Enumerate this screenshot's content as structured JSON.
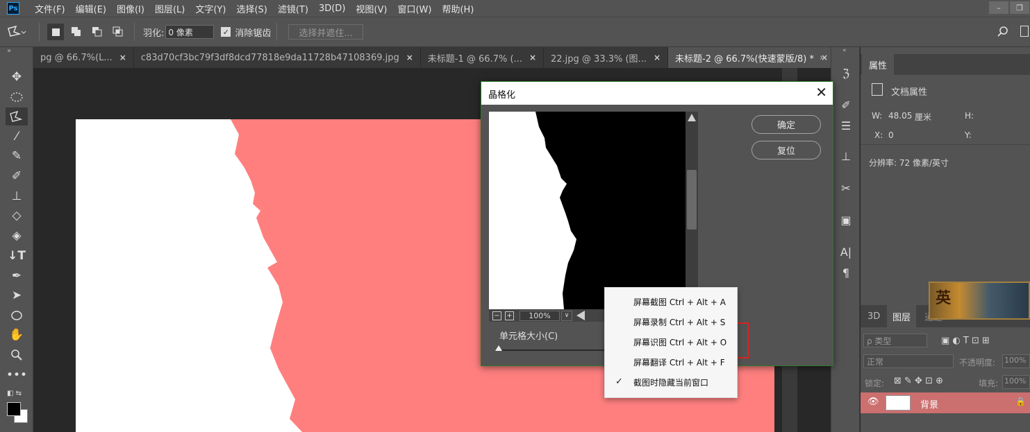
{
  "app": {
    "logo": "Ps"
  },
  "menu": [
    "文件(F)",
    "编辑(E)",
    "图像(I)",
    "图层(L)",
    "文字(Y)",
    "选择(S)",
    "滤镜(T)",
    "3D(D)",
    "视图(V)",
    "窗口(W)",
    "帮助(H)"
  ],
  "window_controls": {
    "minimize": "–",
    "restore": "❐"
  },
  "options": {
    "feather_label": "羽化:",
    "feather_value": "0 像素",
    "antialias_label": "消除锯齿",
    "select_mask": "选择并遮住..."
  },
  "tabs": [
    {
      "label": "pg @ 66.7%(L...",
      "close": "×"
    },
    {
      "label": "c83d70cf3bc79f3df8dcd77818e9da11728b47108369.jpg",
      "close": "×"
    },
    {
      "label": "未标题-1 @ 66.7% (...",
      "close": "×"
    },
    {
      "label": "22.jpg @ 33.3% (图...",
      "close": "×"
    },
    {
      "label": "未标题-2 @ 66.7%(快速蒙版/8) *",
      "close": "×"
    }
  ],
  "tab_more": "»",
  "properties": {
    "tab": "属性",
    "doc_props": "文档属性",
    "w_label": "W:",
    "w_value": "48.05",
    "w_unit": "厘米",
    "h_label": "H:",
    "x_label": "X:",
    "x_value": "0",
    "y_label": "Y:",
    "resolution": "分辨率: 72 像素/英寸"
  },
  "banner_char": "英",
  "layers": {
    "tab_3d": "3D",
    "tab_layers": "图层",
    "tab_paths": "通道",
    "kind": "ρ 类型",
    "blend_mode": "正常",
    "opacity_label": "不透明度:",
    "opacity_value": "100%",
    "lock_label": "锁定:",
    "fill_label": "填充:",
    "fill_value": "100%",
    "layer_name": "背景"
  },
  "dialog": {
    "title": "晶格化",
    "close": "✕",
    "ok": "确定",
    "reset": "复位",
    "zoom_minus": "−",
    "zoom_plus": "+",
    "zoom": "100%",
    "cell_size_label": "单元格大小(C)"
  },
  "context_menu": {
    "items": [
      "屏幕截图 Ctrl + Alt + A",
      "屏幕录制 Ctrl + Alt + S",
      "屏幕识图 Ctrl + Alt + O",
      "屏幕翻译 Ctrl + Alt + F",
      "截图时隐藏当前窗口"
    ],
    "checked_index": 4,
    "check_mark": "✓"
  },
  "colors": {
    "doc_pink": "#ff7f7f",
    "layer_selected": "#cc6f6f",
    "highlight_red": "#e02020"
  }
}
